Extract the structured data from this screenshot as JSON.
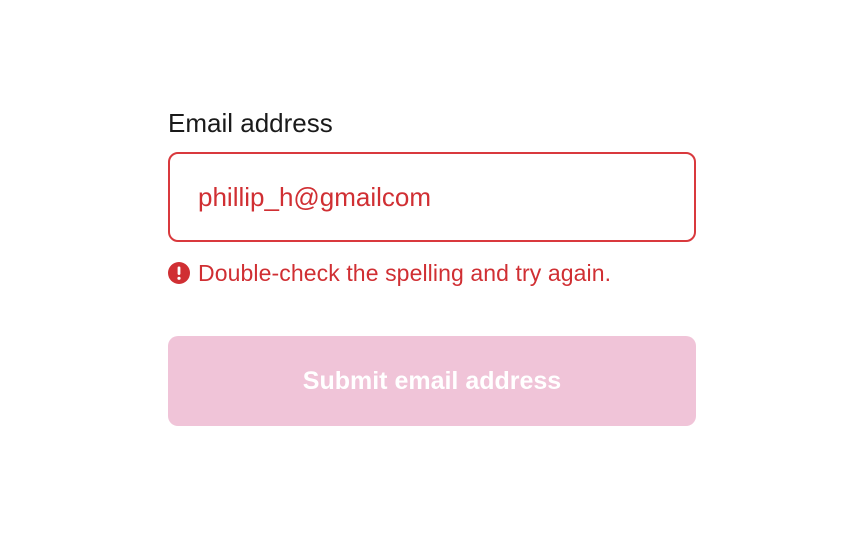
{
  "form": {
    "email_label": "Email address",
    "email_value": "phillip_h@gmailcom",
    "error_icon": "exclamation-circle-icon",
    "error_message": "Double-check the spelling and try again.",
    "submit_label": "Submit email address",
    "submit_disabled": true
  },
  "colors": {
    "error": "#d02f33",
    "input_border_error": "#d9393d",
    "submit_background_disabled": "#f0c4d8",
    "submit_text": "#ffffff",
    "label_text": "#1a1a1a"
  }
}
